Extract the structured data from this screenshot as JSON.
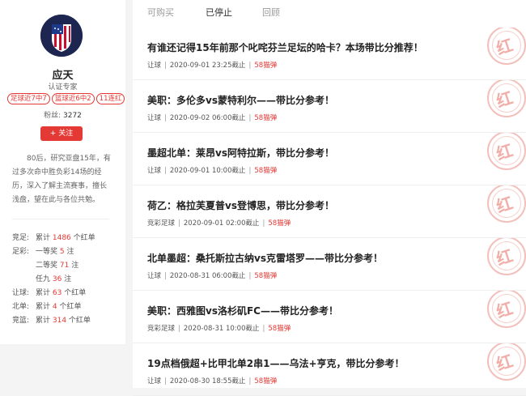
{
  "profile": {
    "name": "应天",
    "role": "认证专家",
    "badges": [
      "足球近7中7",
      "篮球近6中2",
      "11连红"
    ],
    "fans_label": "粉丝:",
    "fans_count": "3272",
    "follow_label": "+ 关注",
    "bio": "80后，研究亚盘15年，有过多次命中胜负彩14场的经历，深入了解主流赛事，擅长浅盘，望在此与各位共勉。"
  },
  "stats": [
    {
      "label": "竞足:",
      "prefix": "累计 ",
      "value": "1486",
      "suffix": " 个红单"
    },
    {
      "label": "足彩:",
      "prefix": "一等奖 ",
      "value": "5",
      "suffix": " 注"
    },
    {
      "label": "",
      "prefix": "二等奖 ",
      "value": "71",
      "suffix": " 注"
    },
    {
      "label": "",
      "prefix": "任九 ",
      "value": "36",
      "suffix": " 注"
    },
    {
      "label": "让球:",
      "prefix": "累计 ",
      "value": "63",
      "suffix": " 个红单"
    },
    {
      "label": "北单:",
      "prefix": "累计 ",
      "value": "4",
      "suffix": " 个红单"
    },
    {
      "label": "竞篮:",
      "prefix": "累计 ",
      "value": "314",
      "suffix": " 个红单"
    }
  ],
  "tabs": [
    "可购买",
    "已停止",
    "回顾"
  ],
  "active_tab": "已停止",
  "stamp_char": "红",
  "articles": [
    {
      "title": "有谁还记得15年前那个叱咤芬兰足坛的哈卡？本场带比分推荐！",
      "category": "让球",
      "time": "2020-09-01 23:25截止",
      "price": "58猫弹"
    },
    {
      "title": "美职：多伦多vs蒙特利尔——带比分参考！",
      "category": "让球",
      "time": "2020-09-02 06:00截止",
      "price": "58猫弹"
    },
    {
      "title": "墨超北单：莱昂vs阿特拉斯，带比分参考！",
      "category": "让球",
      "time": "2020-09-01 10:00截止",
      "price": "58猫弹"
    },
    {
      "title": "荷乙：格拉芙夏普vs登博思，带比分参考！",
      "category": "竞彩足球",
      "time": "2020-09-01 02:00截止",
      "price": "58猫弹"
    },
    {
      "title": "北单墨超：桑托斯拉古纳vs克雷塔罗——带比分参考！",
      "category": "让球",
      "time": "2020-08-31 06:00截止",
      "price": "58猫弹"
    },
    {
      "title": "美职：西雅图vs洛杉矶FC——带比分参考！",
      "category": "竞彩足球",
      "time": "2020-08-31 10:00截止",
      "price": "58猫弹"
    },
    {
      "title": "19点档俄超+比甲北单2串1——乌法+亨克，带比分参考！",
      "category": "让球",
      "time": "2020-08-30 18:55截止",
      "price": "58猫弹"
    }
  ]
}
